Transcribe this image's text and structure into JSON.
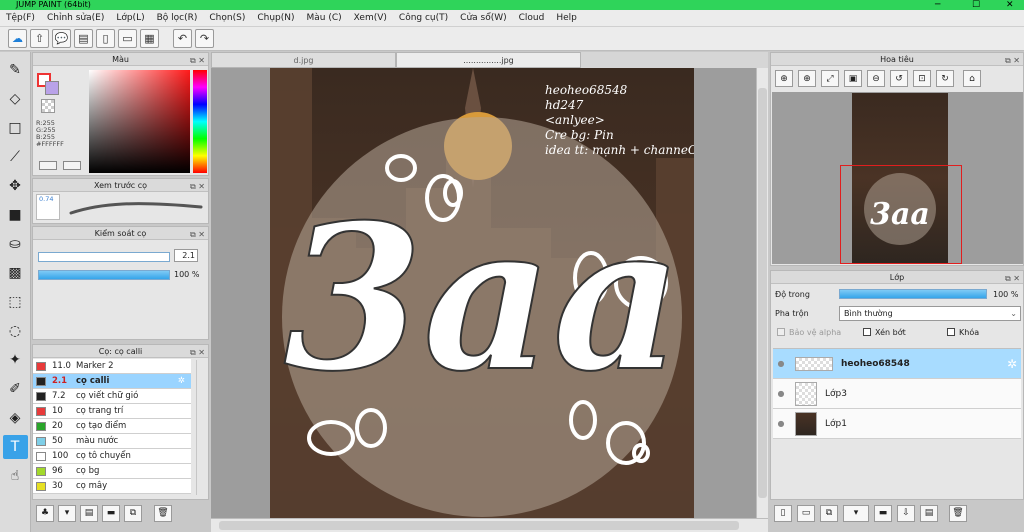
{
  "app": {
    "title": "JUMP PAINT (64bit)"
  },
  "menu": [
    "Tệp(F)",
    "Chỉnh sửa(E)",
    "Lớp(L)",
    "Bộ lọc(R)",
    "Chọn(S)",
    "Chụp(N)",
    "Màu (C)",
    "Xem(V)",
    "Công cụ(T)",
    "Cửa sổ(W)",
    "Cloud",
    "Help"
  ],
  "color_panel": {
    "title": "Màu",
    "rgb": [
      "R:255",
      "G:255",
      "B:255"
    ],
    "hex": "#FFFFFF",
    "main_color": "#ff3b3b"
  },
  "preview_panel": {
    "title": "Xem trước cọ",
    "size_label": "0.74"
  },
  "brush_control": {
    "title": "Kiểm soát cọ",
    "size": "2.1",
    "opacity": "100 %",
    "opacity_pct": 100,
    "size_pct": 100
  },
  "brush_list": {
    "title": "Cọ: cọ calli",
    "items": [
      {
        "size": "11.0",
        "name": "Marker 2",
        "color": "#e83a3a"
      },
      {
        "size": "2.1",
        "name": "cọ calli",
        "color": "#222222",
        "selected": true
      },
      {
        "size": "7.2",
        "name": "cọ viết chữ gió",
        "color": "#222222"
      },
      {
        "size": "10",
        "name": "cọ trang trí",
        "color": "#e83a3a"
      },
      {
        "size": "20",
        "name": "cọ tạo điểm",
        "color": "#2aa52a"
      },
      {
        "size": "50",
        "name": "màu nước",
        "color": "#7fcfe8"
      },
      {
        "size": "100",
        "name": "cọ tô chuyển",
        "color": "#ffffff"
      },
      {
        "size": "96",
        "name": "cọ bg",
        "color": "#a2d82a"
      },
      {
        "size": "30",
        "name": "cọ mây",
        "color": "#e6e023"
      }
    ]
  },
  "tabs": [
    "d.jpg",
    "...............jpg"
  ],
  "artwork": {
    "credits": [
      "heoheo68548",
      "hd247",
      "<anlyee>",
      "Cre bg: Pin",
      "idea tt: mạnh + channeOvO"
    ],
    "big_text": "3aa"
  },
  "navigator": {
    "title": "Hoa tiêu"
  },
  "layers": {
    "title": "Lớp",
    "opacity_label": "Độ trong",
    "opacity_value": "100 %",
    "opacity_pct": 100,
    "blend_label": "Pha trộn",
    "blend_value": "Bình thường",
    "protect_alpha": "Bảo vệ alpha",
    "clip": "Xén bớt",
    "lock": "Khóa",
    "items": [
      {
        "name": "heoheo68548",
        "selected": true
      },
      {
        "name": "Lớp3",
        "selected": false
      },
      {
        "name": "Lớp1",
        "selected": false
      }
    ]
  }
}
